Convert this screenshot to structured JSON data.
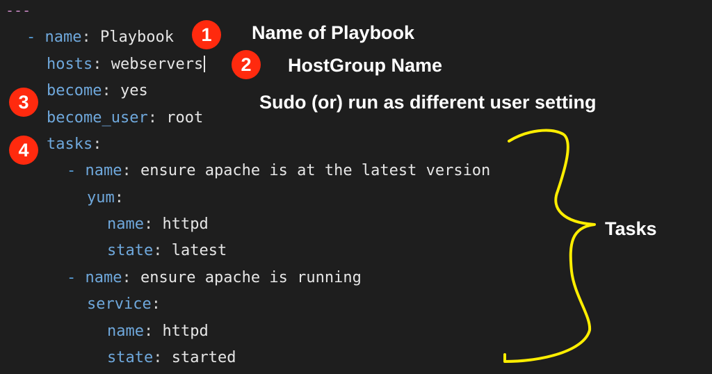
{
  "editor": {
    "doc_start": "---",
    "lines": [
      {
        "dash": "- ",
        "key": "name",
        "value": "Playbook"
      },
      {
        "key": "hosts",
        "value": "webservers"
      },
      {
        "key": "become",
        "value": "yes"
      },
      {
        "key": "become_user",
        "value": "root"
      },
      {
        "key": "tasks",
        "value": ""
      },
      {
        "dash": "- ",
        "key": "name",
        "value": "ensure apache is at the latest version"
      },
      {
        "key": "yum",
        "value": ""
      },
      {
        "key": "name",
        "value": "httpd"
      },
      {
        "key": "state",
        "value": "latest"
      },
      {
        "dash": "- ",
        "key": "name",
        "value": "ensure apache is running"
      },
      {
        "key": "service",
        "value": ""
      },
      {
        "key": "name",
        "value": "httpd"
      },
      {
        "key": "state",
        "value": "started"
      }
    ]
  },
  "annotations": {
    "badges": [
      "1",
      "2",
      "3",
      "4"
    ],
    "name_of_playbook": "Name of Playbook",
    "hostgroup_name": "HostGroup Name",
    "sudo_setting": "Sudo (or) run as different user setting",
    "tasks_label": "Tasks"
  },
  "colors": {
    "background": "#1e1e1e",
    "yaml_key": "#6fa8dc",
    "badge": "#ff2a0e",
    "brace": "#ffee00"
  }
}
